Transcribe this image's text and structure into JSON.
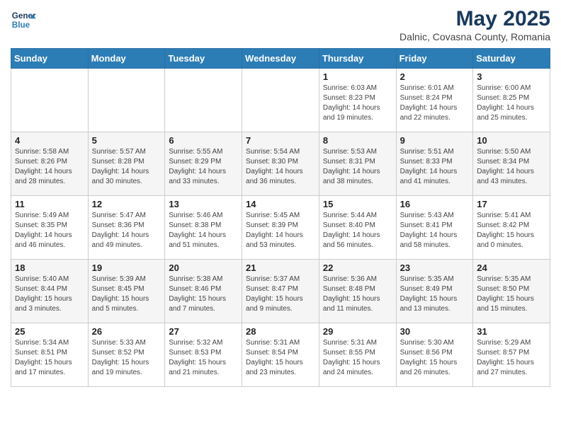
{
  "header": {
    "logo_line1": "General",
    "logo_line2": "Blue",
    "title": "May 2025",
    "subtitle": "Dalnic, Covasna County, Romania"
  },
  "weekdays": [
    "Sunday",
    "Monday",
    "Tuesday",
    "Wednesday",
    "Thursday",
    "Friday",
    "Saturday"
  ],
  "weeks": [
    [
      {
        "day": "",
        "info": ""
      },
      {
        "day": "",
        "info": ""
      },
      {
        "day": "",
        "info": ""
      },
      {
        "day": "",
        "info": ""
      },
      {
        "day": "1",
        "info": "Sunrise: 6:03 AM\nSunset: 8:23 PM\nDaylight: 14 hours\nand 19 minutes."
      },
      {
        "day": "2",
        "info": "Sunrise: 6:01 AM\nSunset: 8:24 PM\nDaylight: 14 hours\nand 22 minutes."
      },
      {
        "day": "3",
        "info": "Sunrise: 6:00 AM\nSunset: 8:25 PM\nDaylight: 14 hours\nand 25 minutes."
      }
    ],
    [
      {
        "day": "4",
        "info": "Sunrise: 5:58 AM\nSunset: 8:26 PM\nDaylight: 14 hours\nand 28 minutes."
      },
      {
        "day": "5",
        "info": "Sunrise: 5:57 AM\nSunset: 8:28 PM\nDaylight: 14 hours\nand 30 minutes."
      },
      {
        "day": "6",
        "info": "Sunrise: 5:55 AM\nSunset: 8:29 PM\nDaylight: 14 hours\nand 33 minutes."
      },
      {
        "day": "7",
        "info": "Sunrise: 5:54 AM\nSunset: 8:30 PM\nDaylight: 14 hours\nand 36 minutes."
      },
      {
        "day": "8",
        "info": "Sunrise: 5:53 AM\nSunset: 8:31 PM\nDaylight: 14 hours\nand 38 minutes."
      },
      {
        "day": "9",
        "info": "Sunrise: 5:51 AM\nSunset: 8:33 PM\nDaylight: 14 hours\nand 41 minutes."
      },
      {
        "day": "10",
        "info": "Sunrise: 5:50 AM\nSunset: 8:34 PM\nDaylight: 14 hours\nand 43 minutes."
      }
    ],
    [
      {
        "day": "11",
        "info": "Sunrise: 5:49 AM\nSunset: 8:35 PM\nDaylight: 14 hours\nand 46 minutes."
      },
      {
        "day": "12",
        "info": "Sunrise: 5:47 AM\nSunset: 8:36 PM\nDaylight: 14 hours\nand 49 minutes."
      },
      {
        "day": "13",
        "info": "Sunrise: 5:46 AM\nSunset: 8:38 PM\nDaylight: 14 hours\nand 51 minutes."
      },
      {
        "day": "14",
        "info": "Sunrise: 5:45 AM\nSunset: 8:39 PM\nDaylight: 14 hours\nand 53 minutes."
      },
      {
        "day": "15",
        "info": "Sunrise: 5:44 AM\nSunset: 8:40 PM\nDaylight: 14 hours\nand 56 minutes."
      },
      {
        "day": "16",
        "info": "Sunrise: 5:43 AM\nSunset: 8:41 PM\nDaylight: 14 hours\nand 58 minutes."
      },
      {
        "day": "17",
        "info": "Sunrise: 5:41 AM\nSunset: 8:42 PM\nDaylight: 15 hours\nand 0 minutes."
      }
    ],
    [
      {
        "day": "18",
        "info": "Sunrise: 5:40 AM\nSunset: 8:44 PM\nDaylight: 15 hours\nand 3 minutes."
      },
      {
        "day": "19",
        "info": "Sunrise: 5:39 AM\nSunset: 8:45 PM\nDaylight: 15 hours\nand 5 minutes."
      },
      {
        "day": "20",
        "info": "Sunrise: 5:38 AM\nSunset: 8:46 PM\nDaylight: 15 hours\nand 7 minutes."
      },
      {
        "day": "21",
        "info": "Sunrise: 5:37 AM\nSunset: 8:47 PM\nDaylight: 15 hours\nand 9 minutes."
      },
      {
        "day": "22",
        "info": "Sunrise: 5:36 AM\nSunset: 8:48 PM\nDaylight: 15 hours\nand 11 minutes."
      },
      {
        "day": "23",
        "info": "Sunrise: 5:35 AM\nSunset: 8:49 PM\nDaylight: 15 hours\nand 13 minutes."
      },
      {
        "day": "24",
        "info": "Sunrise: 5:35 AM\nSunset: 8:50 PM\nDaylight: 15 hours\nand 15 minutes."
      }
    ],
    [
      {
        "day": "25",
        "info": "Sunrise: 5:34 AM\nSunset: 8:51 PM\nDaylight: 15 hours\nand 17 minutes."
      },
      {
        "day": "26",
        "info": "Sunrise: 5:33 AM\nSunset: 8:52 PM\nDaylight: 15 hours\nand 19 minutes."
      },
      {
        "day": "27",
        "info": "Sunrise: 5:32 AM\nSunset: 8:53 PM\nDaylight: 15 hours\nand 21 minutes."
      },
      {
        "day": "28",
        "info": "Sunrise: 5:31 AM\nSunset: 8:54 PM\nDaylight: 15 hours\nand 23 minutes."
      },
      {
        "day": "29",
        "info": "Sunrise: 5:31 AM\nSunset: 8:55 PM\nDaylight: 15 hours\nand 24 minutes."
      },
      {
        "day": "30",
        "info": "Sunrise: 5:30 AM\nSunset: 8:56 PM\nDaylight: 15 hours\nand 26 minutes."
      },
      {
        "day": "31",
        "info": "Sunrise: 5:29 AM\nSunset: 8:57 PM\nDaylight: 15 hours\nand 27 minutes."
      }
    ]
  ]
}
